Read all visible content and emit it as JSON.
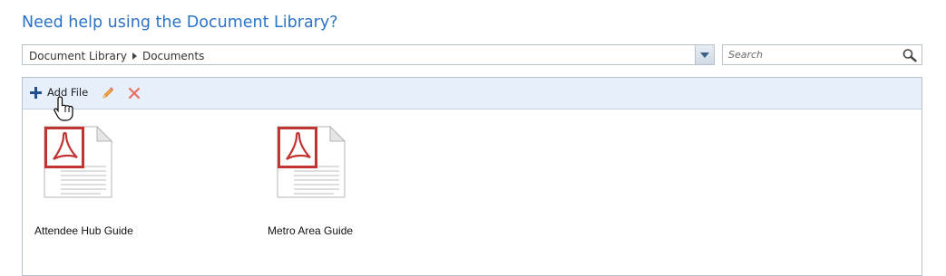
{
  "header": {
    "title": "Need help using the Document Library?"
  },
  "path_selector": {
    "crumbs": [
      "Document Library",
      "Documents"
    ]
  },
  "search": {
    "placeholder": "Search",
    "value": ""
  },
  "toolbar": {
    "add_label": "Add File",
    "icons": [
      "plus-icon",
      "pencil-icon",
      "delete-x-icon"
    ]
  },
  "files": [
    {
      "name": "Attendee Hub Guide",
      "type": "pdf"
    },
    {
      "name": "Metro Area Guide",
      "type": "pdf"
    }
  ],
  "colors": {
    "title": "#2a73c6",
    "toolbar_bg": "#e7f0fa",
    "pdf_red": "#c0302f",
    "delete_red": "#e05a4a",
    "pencil_orange": "#e8913a"
  }
}
